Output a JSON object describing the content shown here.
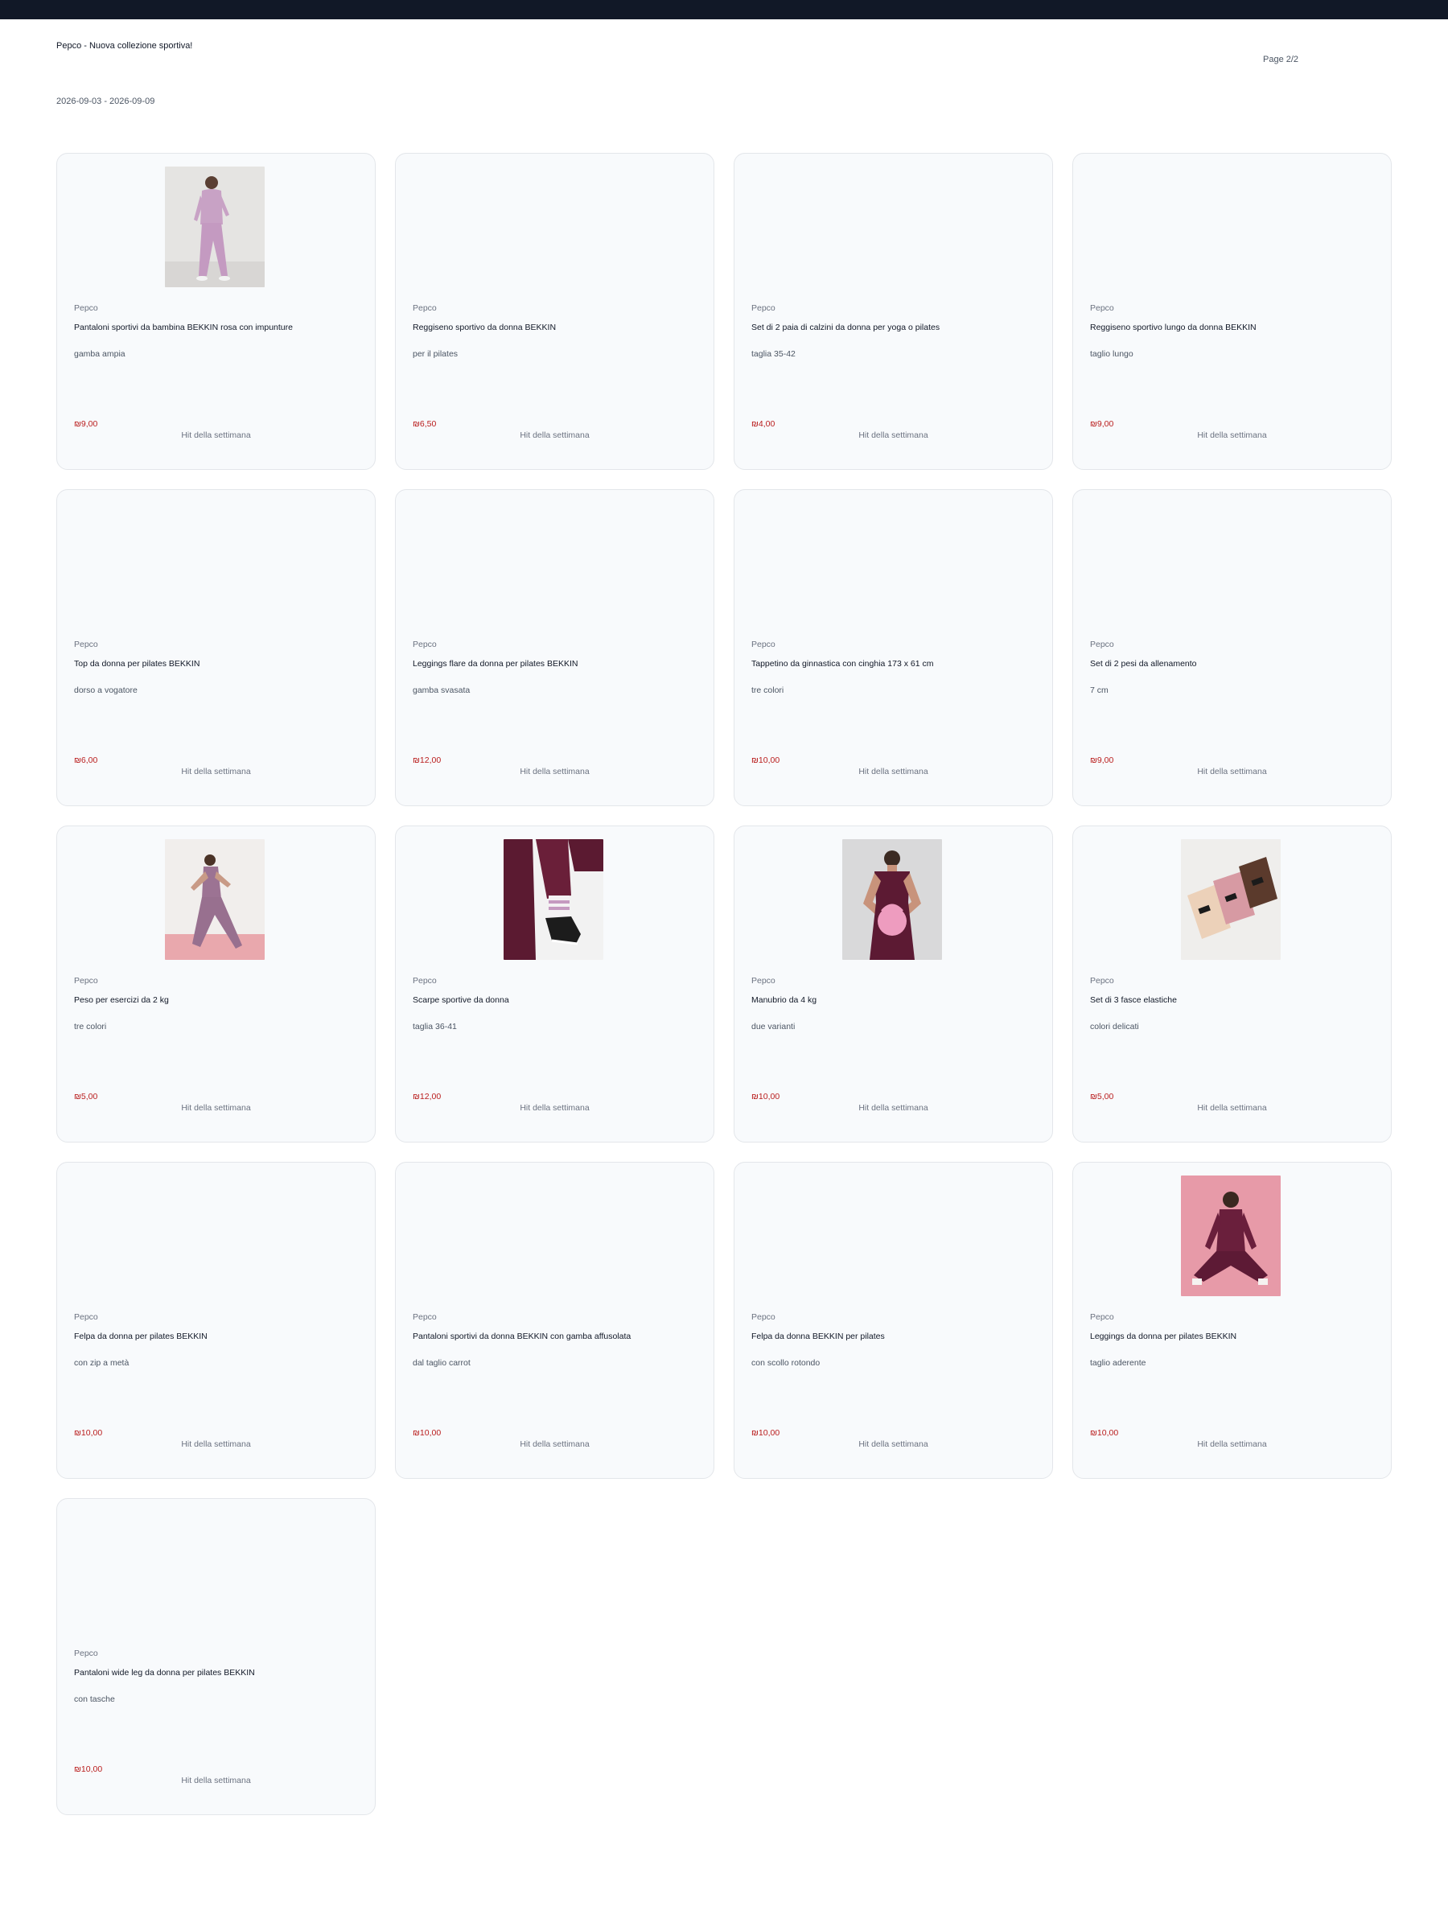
{
  "header": {
    "title": "Pepco - Nuova collezione sportiva!",
    "page": "Page 2/2",
    "dates": "2026-09-03 - 2026-09-09"
  },
  "products": [
    {
      "brand": "Pepco",
      "name": "Pantaloni sportivi da bambina BEKKIN rosa con impunture",
      "sub": "gamba ampia",
      "price": "₪9,00",
      "badge": "Hit della settimana",
      "image": "girl-pink-tracksuit"
    },
    {
      "brand": "Pepco",
      "name": "Reggiseno sportivo da donna BEKKIN",
      "sub": "per il pilates",
      "price": "₪6,50",
      "badge": "Hit della settimana",
      "image": ""
    },
    {
      "brand": "Pepco",
      "name": "Set di 2 paia di calzini da donna per yoga o pilates",
      "sub": "taglia 35-42",
      "price": "₪4,00",
      "badge": "Hit della settimana",
      "image": ""
    },
    {
      "brand": "Pepco",
      "name": "Reggiseno sportivo lungo da donna BEKKIN",
      "sub": "taglio lungo",
      "price": "₪9,00",
      "badge": "Hit della settimana",
      "image": ""
    },
    {
      "brand": "Pepco",
      "name": "Top da donna per pilates BEKKIN",
      "sub": "dorso a vogatore",
      "price": "₪6,00",
      "badge": "Hit della settimana",
      "image": ""
    },
    {
      "brand": "Pepco",
      "name": "Leggings flare da donna per pilates BEKKIN",
      "sub": "gamba svasata",
      "price": "₪12,00",
      "badge": "Hit della settimana",
      "image": ""
    },
    {
      "brand": "Pepco",
      "name": "Tappetino da ginnastica con cinghia 173 x 61 cm",
      "sub": "tre colori",
      "price": "₪10,00",
      "badge": "Hit della settimana",
      "image": ""
    },
    {
      "brand": "Pepco",
      "name": "Set di 2 pesi da allenamento",
      "sub": "7 cm",
      "price": "₪9,00",
      "badge": "Hit della settimana",
      "image": ""
    },
    {
      "brand": "Pepco",
      "name": "Peso per esercizi da 2 kg",
      "sub": "tre colori",
      "price": "₪5,00",
      "badge": "Hit della settimana",
      "image": "woman-lunge-pink"
    },
    {
      "brand": "Pepco",
      "name": "Scarpe sportive da donna",
      "sub": "taglia 36-41",
      "price": "₪12,00",
      "badge": "Hit della settimana",
      "image": "legs-sneaker"
    },
    {
      "brand": "Pepco",
      "name": "Manubrio da 4 kg",
      "sub": "due varianti",
      "price": "₪10,00",
      "badge": "Hit della settimana",
      "image": "woman-kettlebell"
    },
    {
      "brand": "Pepco",
      "name": "Set di 3 fasce elastiche",
      "sub": "colori delicati",
      "price": "₪5,00",
      "badge": "Hit della settimana",
      "image": "resistance-bands"
    },
    {
      "brand": "Pepco",
      "name": "Felpa da donna per pilates BEKKIN",
      "sub": "con zip a metà",
      "price": "₪10,00",
      "badge": "Hit della settimana",
      "image": ""
    },
    {
      "brand": "Pepco",
      "name": "Pantaloni sportivi da donna BEKKIN con gamba affusolata",
      "sub": "dal taglio carrot",
      "price": "₪10,00",
      "badge": "Hit della settimana",
      "image": ""
    },
    {
      "brand": "Pepco",
      "name": "Felpa da donna BEKKIN per pilates",
      "sub": "con scollo rotondo",
      "price": "₪10,00",
      "badge": "Hit della settimana",
      "image": ""
    },
    {
      "brand": "Pepco",
      "name": "Leggings da donna per pilates BEKKIN",
      "sub": "taglio aderente",
      "price": "₪10,00",
      "badge": "Hit della settimana",
      "image": "woman-seated-burgundy"
    },
    {
      "brand": "Pepco",
      "name": "Pantaloni wide leg da donna per pilates BEKKIN",
      "sub": "con tasche",
      "price": "₪10,00",
      "badge": "Hit della settimana",
      "image": ""
    }
  ]
}
